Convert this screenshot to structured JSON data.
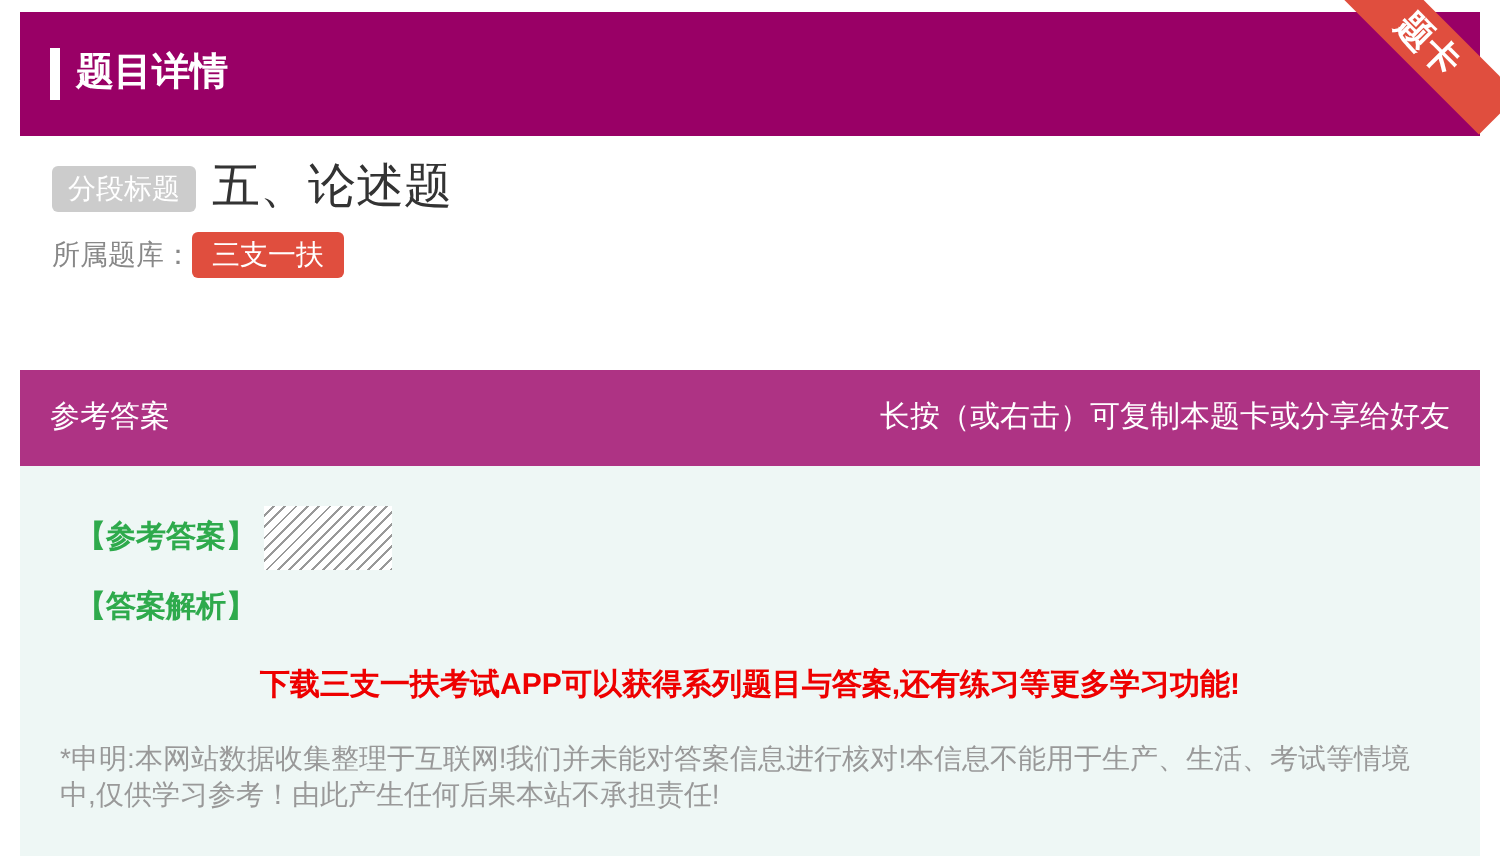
{
  "header": {
    "title": "题目详情",
    "ribbon": "题卡"
  },
  "question": {
    "tag": "分段标题",
    "title": "五、论述题",
    "bank_label": "所属题库：",
    "bank": "三支一扶"
  },
  "answer_panel": {
    "title": "参考答案",
    "hint": "长按（或右击）可复制本题卡或分享给好友",
    "answer_label": "【参考答案】",
    "analysis_label": "【答案解析】",
    "promo": "下载三支一扶考试APP可以获得系列题目与答案,还有练习等更多学习功能!",
    "disclaimer": "*申明:本网站数据收集整理于互联网!我们并未能对答案信息进行核对!本信息不能用于生产、生活、考试等情境中,仅供学习参考！由此产生任何后果本站不承担责任!"
  }
}
